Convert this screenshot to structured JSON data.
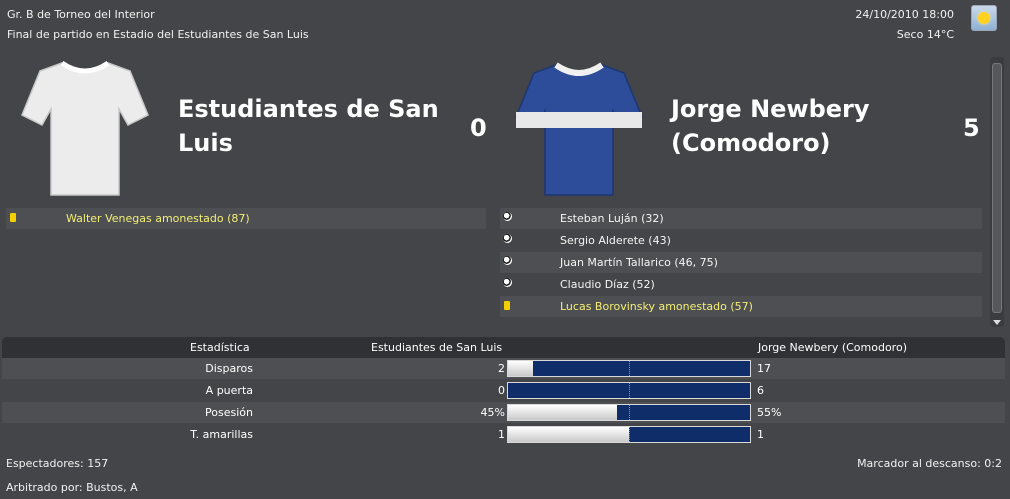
{
  "header": {
    "competition": "Gr. B de Torneo del Interior",
    "match_info": "Final de partido en Estadio del Estudiantes de San Luis",
    "datetime": "24/10/2010 18:00",
    "weather": "Seco 14°C",
    "weather_icon": "sun-icon"
  },
  "home": {
    "name": "Estudiantes de San Luis",
    "score": "0",
    "kit_colors": {
      "body": "#ececec",
      "trim": "#ffffff"
    },
    "events": [
      {
        "type": "yellow-card",
        "text": "Walter Venegas amonestado (87)"
      }
    ]
  },
  "away": {
    "name": "Jorge Newbery (Comodoro)",
    "score": "5",
    "kit_colors": {
      "body": "#2d4d9a",
      "band": "#e8e8e8"
    },
    "events": [
      {
        "type": "goal",
        "text": "Esteban Luján (32)"
      },
      {
        "type": "goal",
        "text": "Sergio Alderete (43)"
      },
      {
        "type": "goal",
        "text": "Juan Martín Tallarico (46, 75)"
      },
      {
        "type": "goal",
        "text": "Claudio Díaz (52)"
      },
      {
        "type": "yellow-card",
        "text": "Lucas Borovinsky amonestado (57)"
      }
    ]
  },
  "stats": {
    "header_label": "Estadística",
    "home_label": "Estudiantes de San Luis",
    "away_label": "Jorge Newbery (Comodoro)",
    "rows": [
      {
        "label": "Disparos",
        "home": "2",
        "away": "17",
        "home_fraction": 0.105
      },
      {
        "label": "A puerta",
        "home": "0",
        "away": "6",
        "home_fraction": 0.0
      },
      {
        "label": "Posesión",
        "home": "45%",
        "away": "55%",
        "home_fraction": 0.45
      },
      {
        "label": "T. amarillas",
        "home": "1",
        "away": "1",
        "home_fraction": 0.5
      }
    ],
    "bar_colors": {
      "home": "#ffffff",
      "away": "#0f2d69"
    }
  },
  "footer": {
    "spectators": "Espectadores: 157",
    "referee": "Arbitrado por: Bustos, A",
    "halftime": "Marcador al descanso: 0:2"
  }
}
